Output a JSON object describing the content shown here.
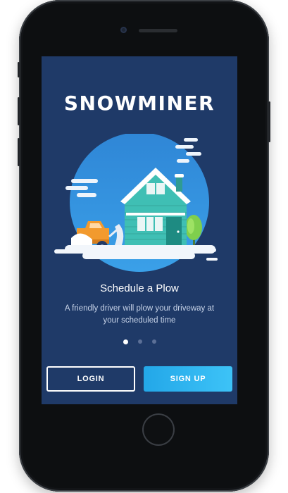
{
  "app": {
    "logo_text": "SNOWMINER"
  },
  "onboarding": {
    "headline": "Schedule a Plow",
    "description": "A friendly driver will plow your driveway at your scheduled time",
    "pagination": {
      "total": 3,
      "current": 1
    },
    "illustration": "snowy-house-with-snowplow-truck"
  },
  "actions": {
    "login_label": "LOGIN",
    "signup_label": "SIGN UP"
  },
  "colors": {
    "screen_background": "#1f3a68",
    "signup_button": "#2bb3ef",
    "house": "#3fbfb4",
    "truck": "#f29a2e"
  }
}
